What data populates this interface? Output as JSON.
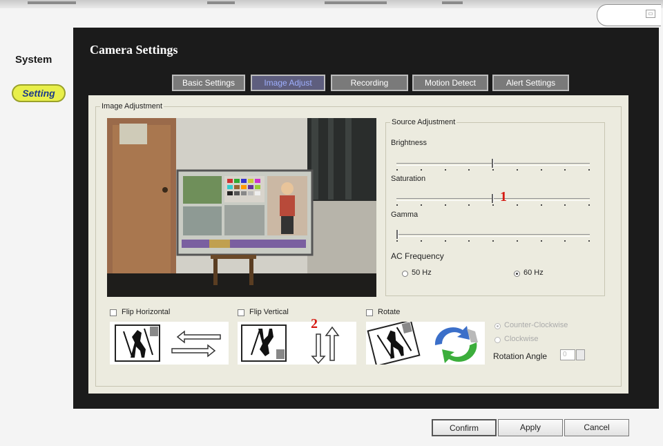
{
  "nav": {
    "system": "System",
    "setting": "Setting"
  },
  "panel": {
    "title": "Camera Settings"
  },
  "tabs": [
    "Basic Settings",
    "Image Adjust",
    "Recording",
    "Motion Detect",
    "Alert Settings"
  ],
  "active_tab": "Image Adjust",
  "image_adjustment": {
    "group_label": "Image Adjustment",
    "source": {
      "group_label": "Source Adjustment",
      "brightness": {
        "label": "Brightness",
        "level_percent": 50
      },
      "saturation": {
        "label": "Saturation",
        "level_percent": 50
      },
      "gamma": {
        "label": "Gamma",
        "level_percent": 0
      },
      "ac_frequency": {
        "label": "AC Frequency",
        "options": [
          "50 Hz",
          "60 Hz"
        ],
        "selected": "60 Hz"
      }
    },
    "flip_horizontal": {
      "label": "Flip Horizontal",
      "checked": false
    },
    "flip_vertical": {
      "label": "Flip Vertical",
      "checked": false
    },
    "rotate": {
      "label": "Rotate",
      "checked": false,
      "direction_options": [
        "Counter-Clockwise",
        "Clockwise"
      ],
      "direction_selected": "Counter-Clockwise",
      "angle_label": "Rotation Angle",
      "angle_value": "0"
    }
  },
  "annotations": {
    "marker1": "1",
    "marker2": "2"
  },
  "buttons": {
    "confirm": "Confirm",
    "apply": "Apply",
    "cancel": "Cancel"
  },
  "colors": {
    "panel_bg": "#1b1b1b",
    "content_bg": "#ecebdf",
    "setting_pill": "#e8ef4a",
    "active_tab_text": "#9fb0ff",
    "annotation": "#d61a12"
  },
  "icons": [
    "flip-horizontal-arrows-icon",
    "flip-vertical-arrows-icon",
    "rotate-cycle-icon"
  ]
}
